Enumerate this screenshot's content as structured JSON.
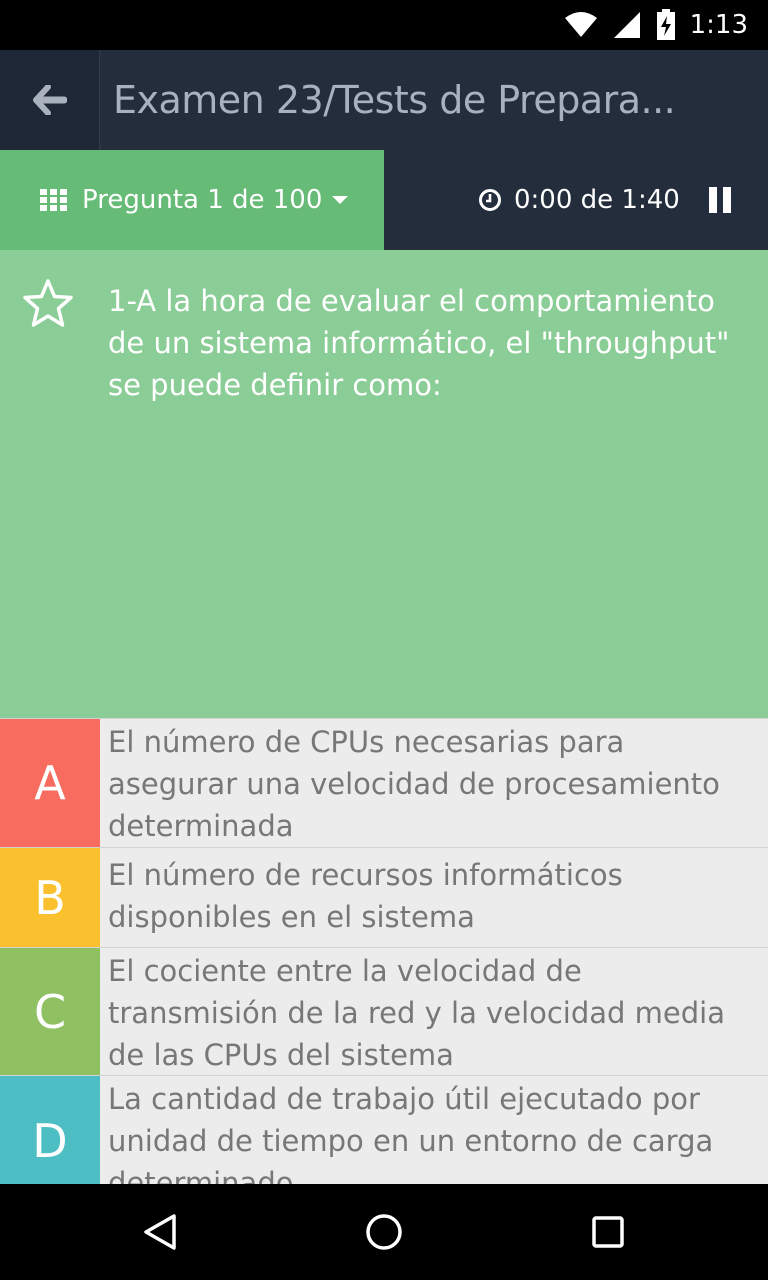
{
  "status_bar": {
    "time": "1:13"
  },
  "app_bar": {
    "title": "Examen 23/Tests de Prepara..."
  },
  "toolbar": {
    "question_counter": "Pregunta 1 de 100",
    "timer": "0:00 de 1:40"
  },
  "question": {
    "text": "1-A la hora de evaluar el comportamiento de un sistema informático, el \"throughput\" se puede definir como:"
  },
  "answers": [
    {
      "letter": "A",
      "text": "El número de CPUs necesarias para asegurar una velocidad de procesamiento determinada",
      "color": "#f76c5e"
    },
    {
      "letter": "B",
      "text": "El número de recursos informáticos disponibles en el sistema",
      "color": "#fbc02d"
    },
    {
      "letter": "C",
      "text": "El cociente entre la velocidad de transmisión de la red y la velocidad media de las CPUs del sistema",
      "color": "#8fc163"
    },
    {
      "letter": "D",
      "text": "La cantidad de trabajo útil ejecutado por unidad de tiempo en un entorno de carga determinado",
      "color": "#4dbfc4"
    }
  ],
  "colors": {
    "app_bar": "#232d3c",
    "question_selector": "#66bb77",
    "question_background": "#8bcd96",
    "answer_background": "#ececec"
  }
}
